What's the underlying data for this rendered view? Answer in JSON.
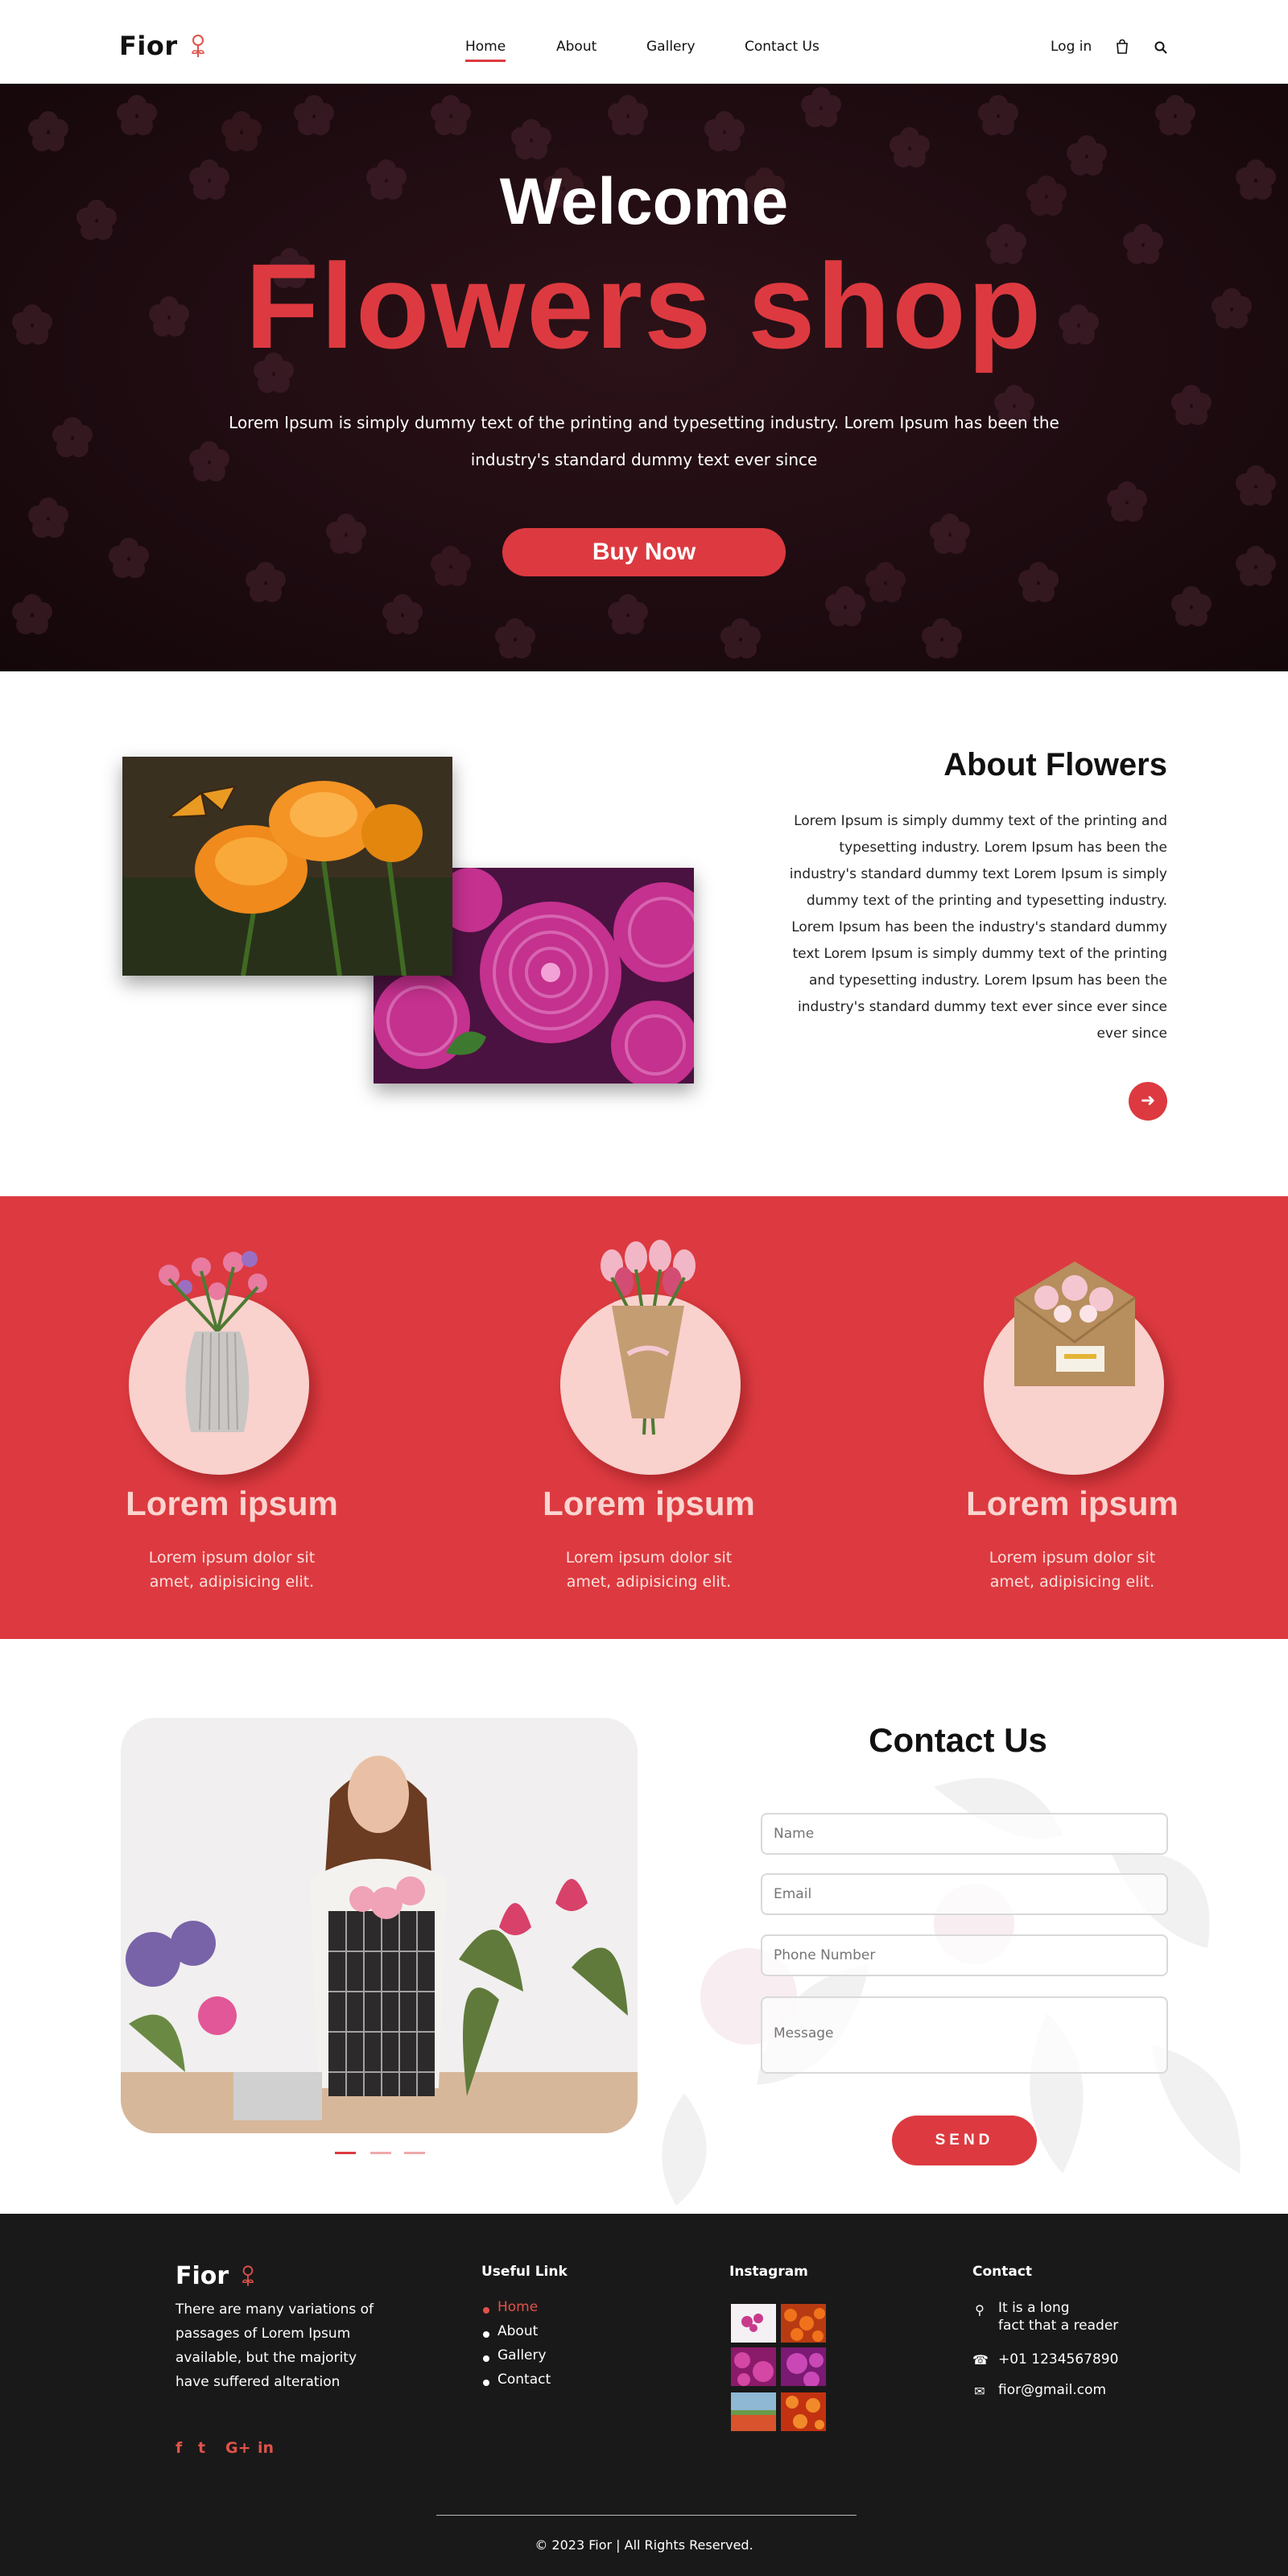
{
  "header": {
    "logo": "Fior",
    "nav": [
      "Home",
      "About",
      "Gallery",
      "Contact Us"
    ],
    "login": "Log in"
  },
  "hero": {
    "welcome": "Welcome",
    "title": "Flowers shop",
    "text": "Lorem Ipsum is simply dummy text of the printing and typesetting industry. Lorem Ipsum has been the industry's standard dummy text ever since",
    "button": "Buy Now"
  },
  "about": {
    "title": "About Flowers",
    "text": "Lorem Ipsum is simply dummy text of the printing and typesetting industry. Lorem Ipsum has been the industry's standard dummy text Lorem Ipsum is simply dummy text of the printing and typesetting industry. Lorem Ipsum has been the industry's standard dummy text Lorem Ipsum is simply dummy text of the printing and typesetting industry. Lorem Ipsum has been the industry's standard dummy text ever since ever since ever since"
  },
  "features": [
    {
      "title": "Lorem ipsum",
      "text": "Lorem ipsum dolor sit amet, adipisicing elit."
    },
    {
      "title": "Lorem ipsum",
      "text": "Lorem ipsum dolor sit amet, adipisicing elit."
    },
    {
      "title": "Lorem ipsum",
      "text": "Lorem ipsum dolor sit amet, adipisicing elit."
    }
  ],
  "contact": {
    "title": "Contact Us",
    "name_placeholder": "Name",
    "email_placeholder": "Email",
    "phone_placeholder": "Phone Number",
    "message_placeholder": "Message",
    "send": "SEND"
  },
  "footer": {
    "logo": "Fior",
    "description": "There are many variations of passages of Lorem Ipsum available, but the majority have suffered alteration",
    "social": [
      "f",
      "t",
      "G+",
      "in"
    ],
    "useful_title": "Useful Link",
    "links": [
      "Home",
      "About",
      "Gallery",
      "Contact"
    ],
    "instagram_title": "Instagram",
    "contact_title": "Contact",
    "address_line1": "It is a long",
    "address_line2": "fact that a reader",
    "phone": "+01 1234567890",
    "email": "fior@gmail.com",
    "copyright": "© 2023 Fior | All Rights Reserved."
  },
  "colors": {
    "accent": "#dc3a40",
    "footer_bg": "#1a1919",
    "feature_circle": "#f9d1cd"
  }
}
